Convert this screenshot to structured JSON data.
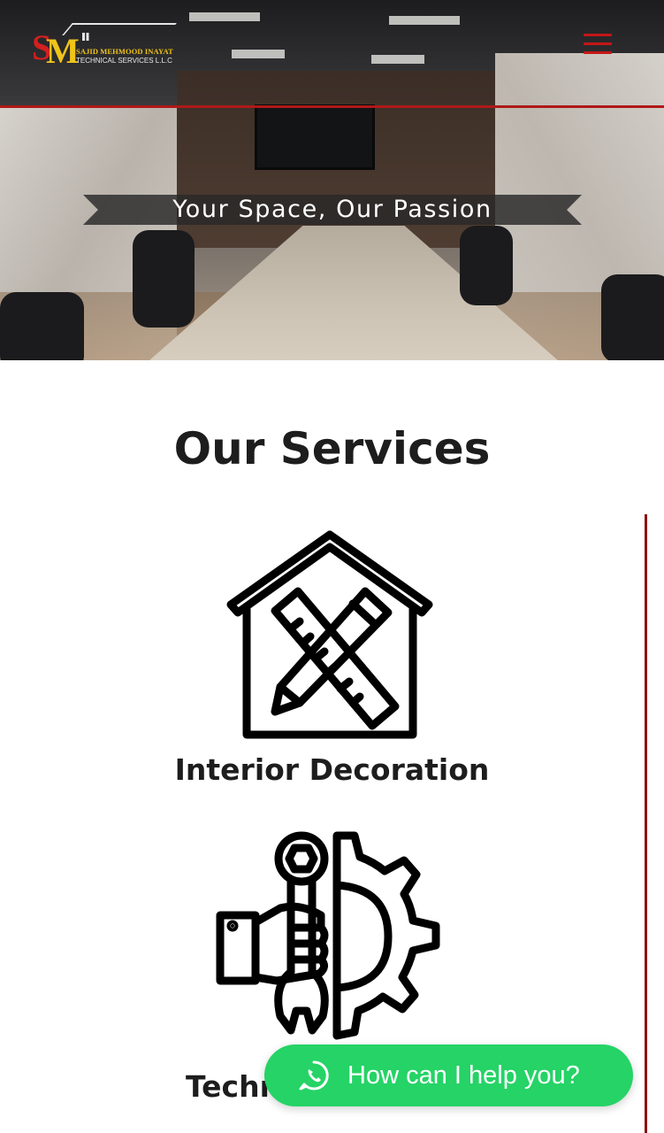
{
  "header": {
    "logo": {
      "line1": "SAJID MEHMOOD INAYAT",
      "line2": "TECHNICAL SERVICES L.L.C",
      "monogram": "SM"
    },
    "menu_icon": "hamburger-menu-icon"
  },
  "hero": {
    "tagline": "Your Space, Our Passion"
  },
  "services": {
    "title": "Our Services",
    "items": [
      {
        "label": "Interior Decoration",
        "icon": "house-ruler-pencil-icon"
      },
      {
        "label": "Techni",
        "icon": "hand-wrench-gear-icon"
      }
    ]
  },
  "chat": {
    "label": "How can I help you?",
    "icon": "whatsapp-icon"
  },
  "colors": {
    "accent_red": "#c41616",
    "whatsapp_green": "#25d366",
    "text_dark": "#1d1d1d"
  }
}
